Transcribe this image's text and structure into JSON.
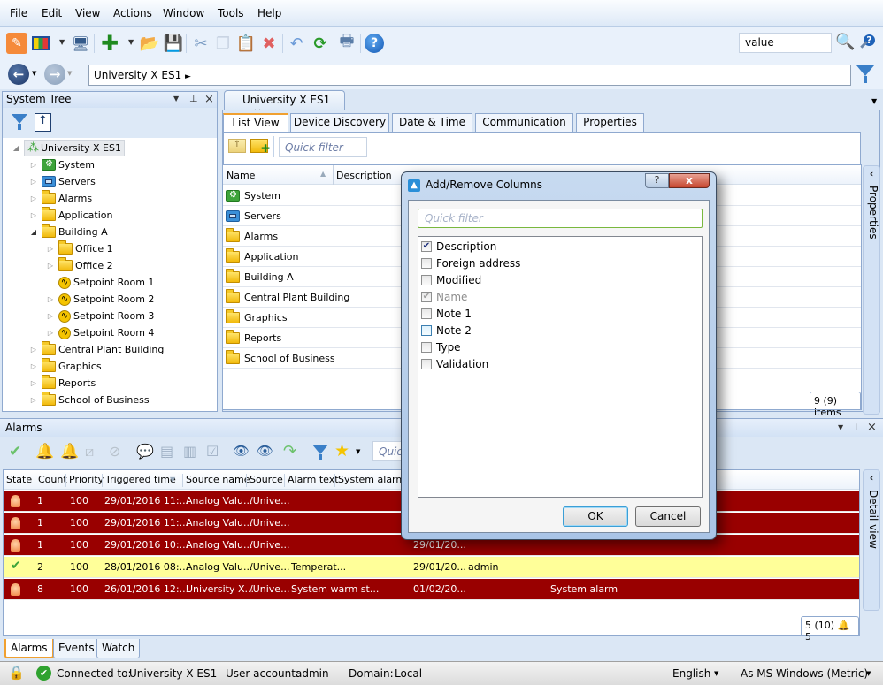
{
  "menu": [
    "File",
    "Edit",
    "View",
    "Actions",
    "Window",
    "Tools",
    "Help"
  ],
  "toolbar": {
    "icons": [
      "properties-icon",
      "layout-icon",
      "workstation-icon",
      "add-icon",
      "open-icon",
      "save-icon",
      "cut-icon",
      "copy-icon",
      "paste-icon",
      "delete-icon",
      "undo-icon",
      "refresh-icon",
      "print-icon",
      "help-icon"
    ],
    "search_value": "value"
  },
  "address": {
    "path": "University X ES1",
    "arrow": "►"
  },
  "system_tree": {
    "title": "System Tree",
    "root": "University X ES1",
    "items": [
      {
        "label": "System",
        "icon": "system",
        "level": 1,
        "expander": "closed"
      },
      {
        "label": "Servers",
        "icon": "servers",
        "level": 1,
        "expander": "closed"
      },
      {
        "label": "Alarms",
        "icon": "folder",
        "level": 1,
        "expander": "closed"
      },
      {
        "label": "Application",
        "icon": "folder",
        "level": 1,
        "expander": "closed"
      },
      {
        "label": "Building A",
        "icon": "folder",
        "level": 1,
        "expander": "open"
      },
      {
        "label": "Office 1",
        "icon": "folder",
        "level": 2,
        "expander": "closed"
      },
      {
        "label": "Office 2",
        "icon": "folder",
        "level": 2,
        "expander": "closed"
      },
      {
        "label": "Setpoint Room 1",
        "icon": "setpoint",
        "level": 2,
        "expander": "none"
      },
      {
        "label": "Setpoint Room 2",
        "icon": "setpoint",
        "level": 2,
        "expander": "closed"
      },
      {
        "label": "Setpoint Room 3",
        "icon": "setpoint",
        "level": 2,
        "expander": "closed"
      },
      {
        "label": "Setpoint Room 4",
        "icon": "setpoint",
        "level": 2,
        "expander": "closed"
      },
      {
        "label": "Central Plant Building",
        "icon": "folder",
        "level": 1,
        "expander": "closed"
      },
      {
        "label": "Graphics",
        "icon": "folder",
        "level": 1,
        "expander": "closed"
      },
      {
        "label": "Reports",
        "icon": "folder",
        "level": 1,
        "expander": "closed"
      },
      {
        "label": "School of Business",
        "icon": "folder",
        "level": 1,
        "expander": "closed"
      }
    ]
  },
  "document_tab": {
    "label": "University X ES1",
    "close": "×"
  },
  "subtabs": [
    "List View",
    "Device Discovery",
    "Date & Time",
    "Communication",
    "Properties"
  ],
  "list_view": {
    "quick_filter_placeholder": "Quick filter",
    "columns": [
      "Name",
      "Description"
    ],
    "rows": [
      {
        "name": "System",
        "icon": "system"
      },
      {
        "name": "Servers",
        "icon": "servers"
      },
      {
        "name": "Alarms",
        "icon": "folder"
      },
      {
        "name": "Application",
        "icon": "folder"
      },
      {
        "name": "Building A",
        "icon": "folder"
      },
      {
        "name": "Central Plant Building",
        "icon": "folder"
      },
      {
        "name": "Graphics",
        "icon": "folder"
      },
      {
        "name": "Reports",
        "icon": "folder"
      },
      {
        "name": "School of Business",
        "icon": "folder"
      }
    ],
    "item_count": "9 (9) items"
  },
  "side_tabs": {
    "properties": "Properties",
    "detail_view": "Detail view"
  },
  "alarms": {
    "title": "Alarms",
    "quick_filter_placeholder": "Quick filter",
    "columns": [
      "State",
      "Count",
      "Priority",
      "Triggered time",
      "Source name",
      "Source",
      "Alarm text",
      "System alarm I"
    ],
    "rows": [
      {
        "state": "alarm",
        "count": "1",
        "priority": "100",
        "triggered": "29/01/2016 11:...",
        "source_name": "Analog Valu...",
        "source": "/Unive...",
        "alarm_text": "",
        "extra1": "",
        "extra2": "",
        "extra3": "",
        "color": "red"
      },
      {
        "state": "alarm",
        "count": "1",
        "priority": "100",
        "triggered": "29/01/2016 11:...",
        "source_name": "Analog Valu...",
        "source": "/Unive...",
        "alarm_text": "",
        "extra1": "",
        "extra2": "",
        "extra3": "",
        "color": "red"
      },
      {
        "state": "alarm",
        "count": "1",
        "priority": "100",
        "triggered": "29/01/2016 10:...",
        "source_name": "Analog Valu...",
        "source": "/Unive...",
        "alarm_text": "",
        "extra1": "29/01/20...",
        "extra2": "",
        "extra3": "",
        "color": "red"
      },
      {
        "state": "acknowledged",
        "count": "2",
        "priority": "100",
        "triggered": "28/01/2016 08:...",
        "source_name": "Analog Valu...",
        "source": "/Unive...",
        "alarm_text": "Temperat...",
        "extra1": "29/01/20...",
        "extra2": "admin",
        "extra3": "",
        "color": "yellow"
      },
      {
        "state": "alarm",
        "count": "8",
        "priority": "100",
        "triggered": "26/01/2016 12:...",
        "source_name": "University X...",
        "source": "/Unive...",
        "alarm_text": "System warm st...",
        "extra1": "01/02/20...",
        "extra2": "",
        "extra3": "System alarm",
        "color": "red"
      }
    ],
    "count": "5 (10)",
    "bell_count": "5"
  },
  "bottom_tabs": [
    "Alarms",
    "Events",
    "Watch"
  ],
  "status_bar": {
    "connected_label": "Connected to:",
    "connected_value": "University X ES1",
    "user_label": "User account:",
    "user_value": "admin",
    "domain_label": "Domain:",
    "domain_value": "Local",
    "language": "English",
    "units": "As MS Windows (Metric)"
  },
  "dialog": {
    "title": "Add/Remove Columns",
    "help": "?",
    "close": "x",
    "quick_filter_placeholder": "Quick filter",
    "columns": [
      {
        "label": "Description",
        "checked": true,
        "disabled": false
      },
      {
        "label": "Foreign address",
        "checked": false,
        "disabled": false
      },
      {
        "label": "Modified",
        "checked": false,
        "disabled": false
      },
      {
        "label": "Name",
        "checked": true,
        "disabled": true
      },
      {
        "label": "Note 1",
        "checked": false,
        "disabled": false
      },
      {
        "label": "Note 2",
        "checked": false,
        "disabled": false,
        "hover": true
      },
      {
        "label": "Type",
        "checked": false,
        "disabled": false
      },
      {
        "label": "Validation",
        "checked": false,
        "disabled": false
      }
    ],
    "ok": "OK",
    "cancel": "Cancel"
  },
  "colors": {
    "alarm_row": "#990000",
    "acknowledged_row": "#ffff99",
    "accent": "#3a8fd8"
  }
}
